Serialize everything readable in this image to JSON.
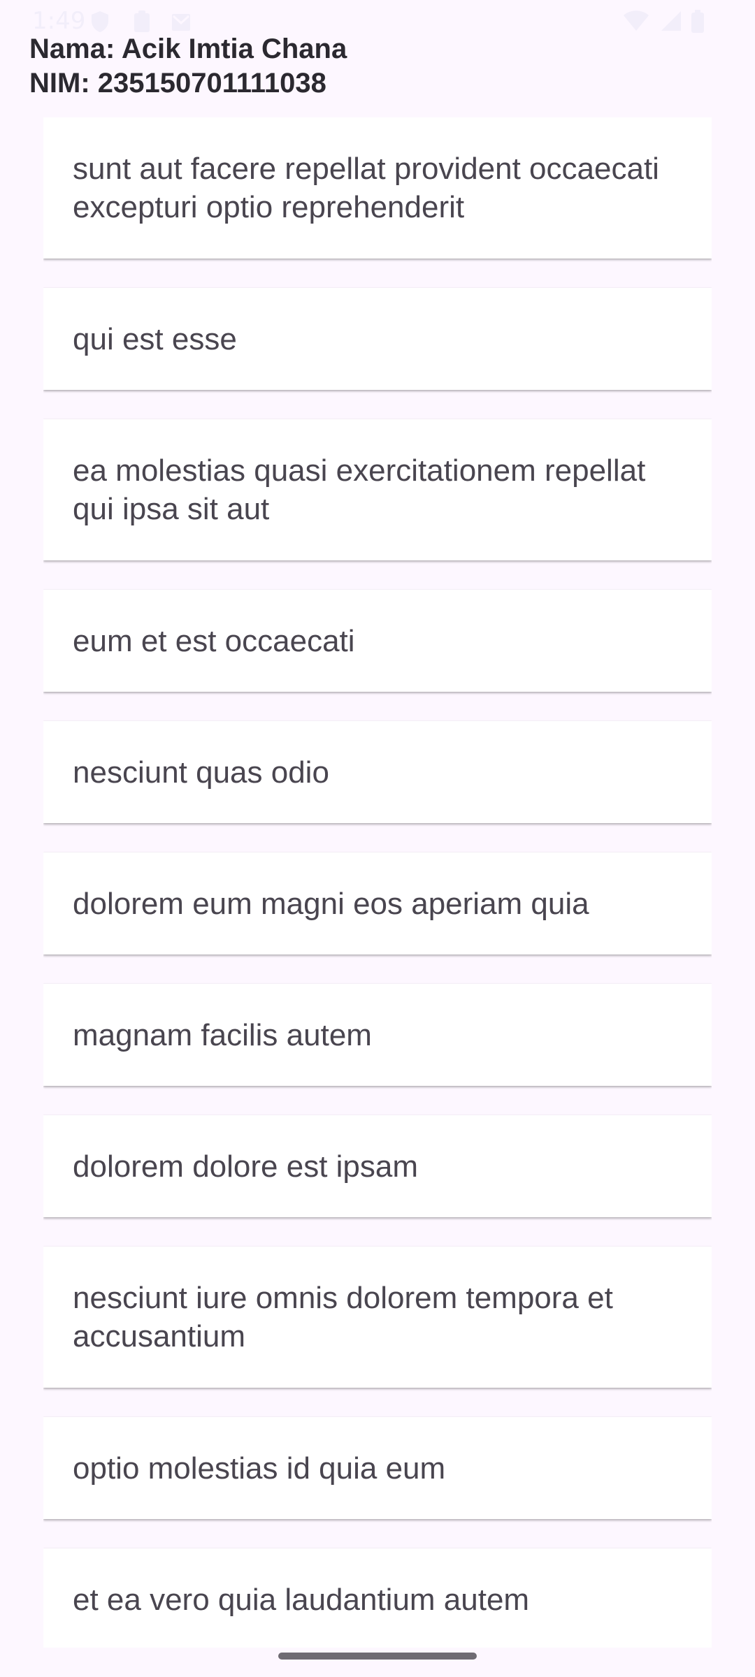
{
  "status_bar": {
    "time": "1:49",
    "left_icons": [
      "shield-icon",
      "clipboard-icon",
      "mail-icon"
    ],
    "right_icons": [
      "wifi-icon",
      "signal-icon",
      "battery-icon"
    ]
  },
  "header": {
    "name_line": "Nama: Acik Imtia Chana",
    "nim_line": "NIM: 235150701111038"
  },
  "posts": [
    {
      "title": "sunt aut facere repellat provident occaecati excepturi optio reprehenderit"
    },
    {
      "title": "qui est esse"
    },
    {
      "title": "ea molestias quasi exercitationem repellat qui ipsa sit aut"
    },
    {
      "title": "eum et est occaecati"
    },
    {
      "title": "nesciunt quas odio"
    },
    {
      "title": "dolorem eum magni eos aperiam quia"
    },
    {
      "title": "magnam facilis autem"
    },
    {
      "title": "dolorem dolore est ipsam"
    },
    {
      "title": "nesciunt iure omnis dolorem tempora et accusantium"
    },
    {
      "title": "optio molestias id quia eum"
    },
    {
      "title": "et ea vero quia laudantium autem"
    }
  ]
}
